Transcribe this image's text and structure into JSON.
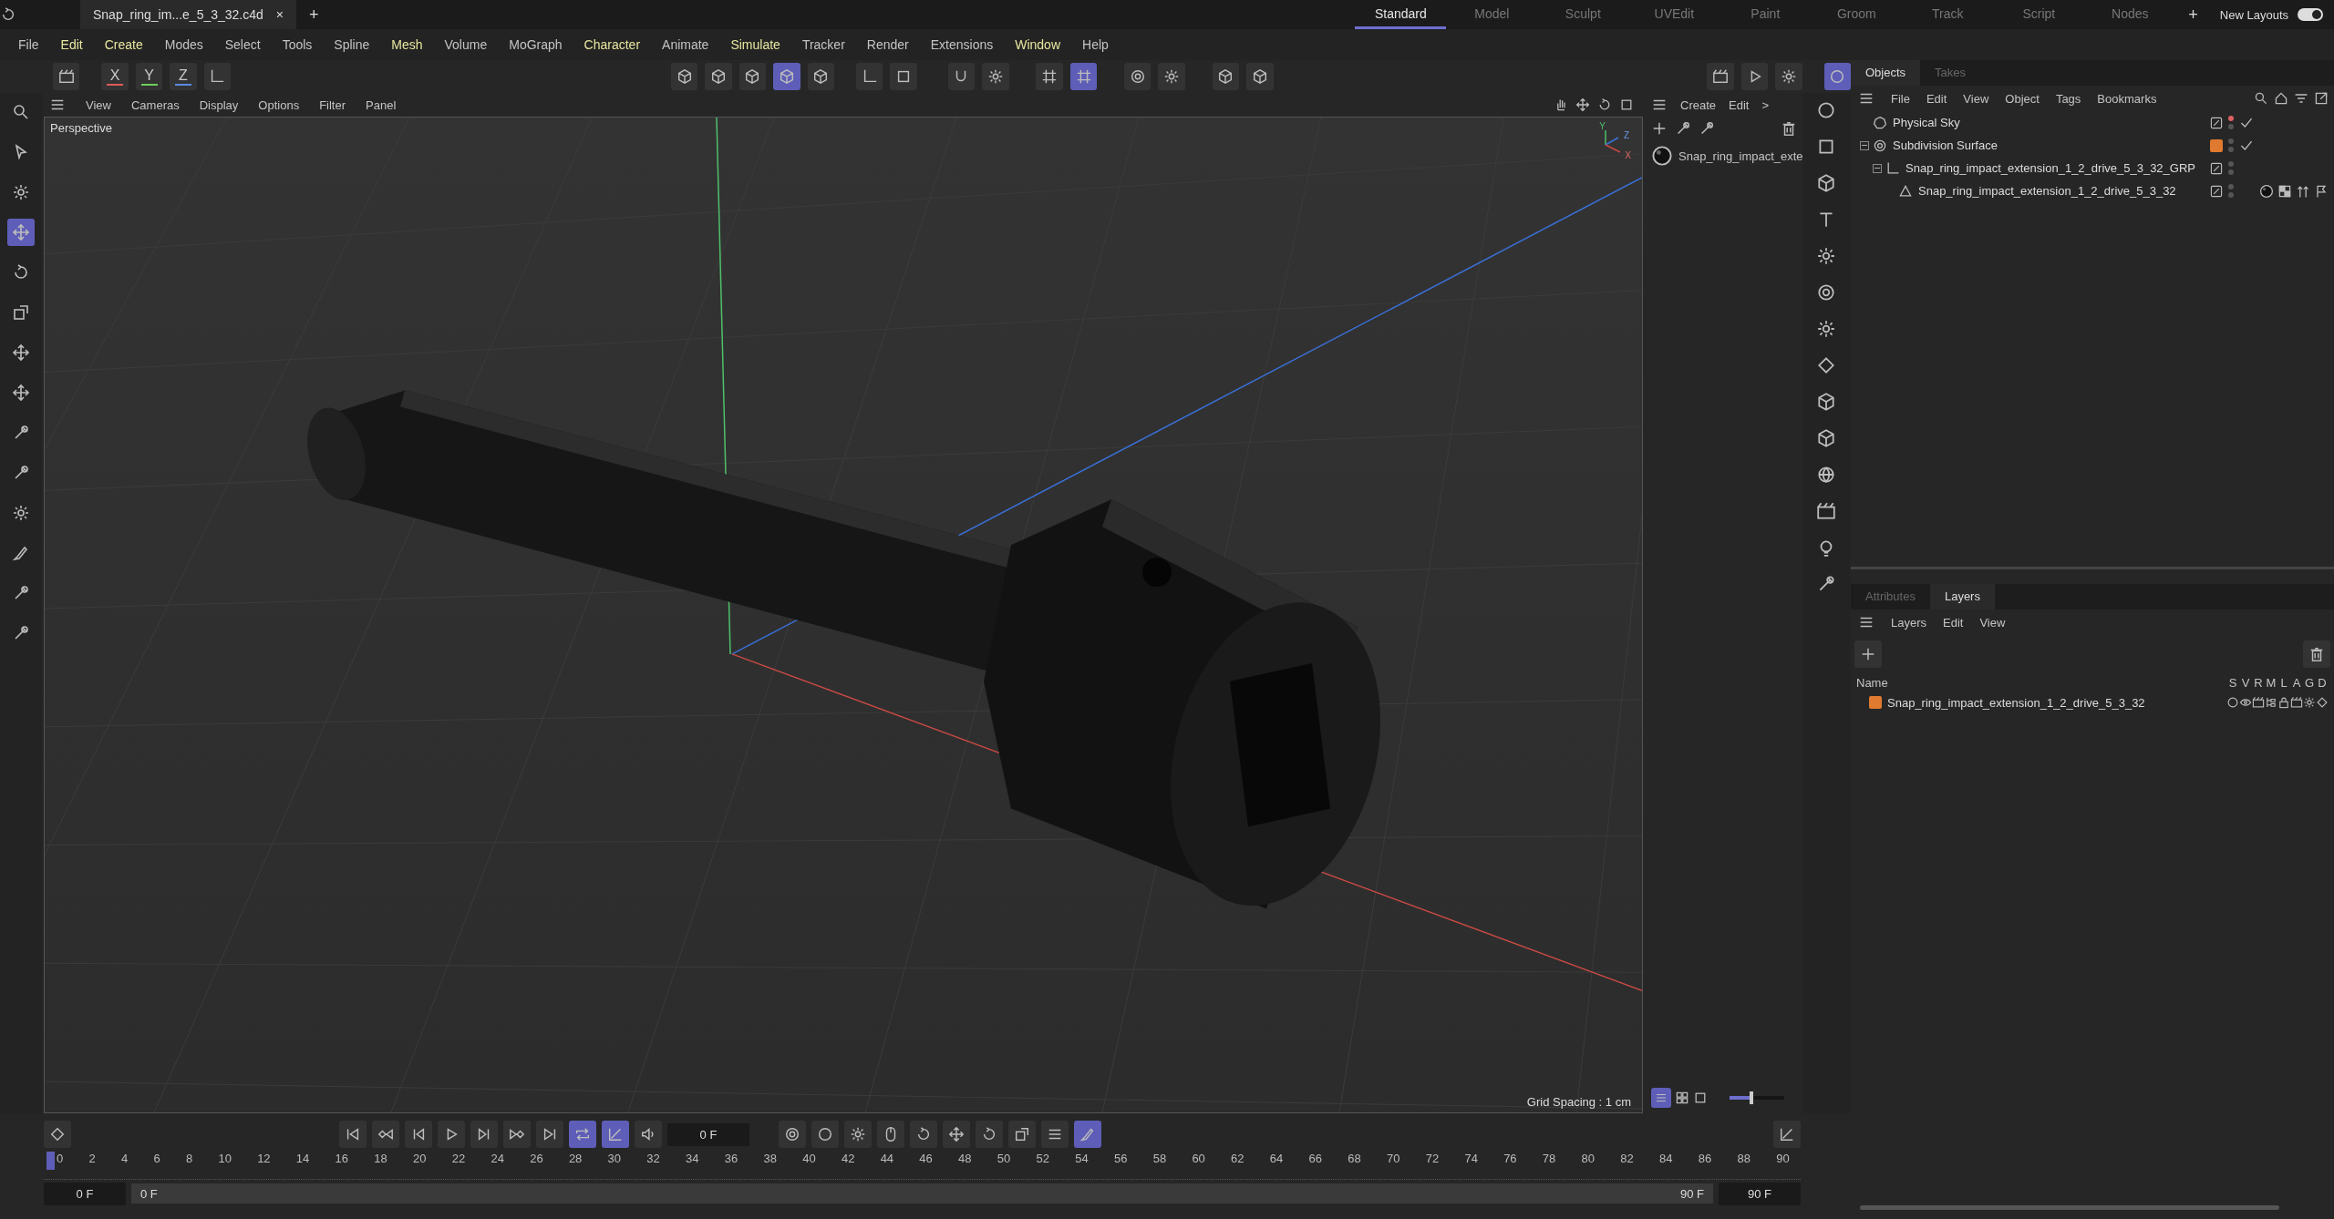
{
  "title_bar": {
    "tab": "Snap_ring_im...e_5_3_32.c4d",
    "close": "×",
    "add": "+"
  },
  "layouts": [
    {
      "label": "Standard",
      "selected": true
    },
    {
      "label": "Model",
      "selected": false
    },
    {
      "label": "Sculpt",
      "selected": false
    },
    {
      "label": "UVEdit",
      "selected": false
    },
    {
      "label": "Paint",
      "selected": false
    },
    {
      "label": "Groom",
      "selected": false
    },
    {
      "label": "Track",
      "selected": false
    },
    {
      "label": "Script",
      "selected": false
    },
    {
      "label": "Nodes",
      "selected": false
    }
  ],
  "layout_add": "+",
  "new_layouts": {
    "label": "New Layouts",
    "on": true
  },
  "menu": [
    {
      "label": "File",
      "highlight": false
    },
    {
      "label": "Edit",
      "highlight": true
    },
    {
      "label": "Create",
      "highlight": true
    },
    {
      "label": "Modes",
      "highlight": false
    },
    {
      "label": "Select",
      "highlight": false
    },
    {
      "label": "Tools",
      "highlight": false
    },
    {
      "label": "Spline",
      "highlight": false
    },
    {
      "label": "Mesh",
      "highlight": true
    },
    {
      "label": "Volume",
      "highlight": false
    },
    {
      "label": "MoGraph",
      "highlight": false
    },
    {
      "label": "Character",
      "highlight": true
    },
    {
      "label": "Animate",
      "highlight": false
    },
    {
      "label": "Simulate",
      "highlight": true
    },
    {
      "label": "Tracker",
      "highlight": false
    },
    {
      "label": "Render",
      "highlight": false
    },
    {
      "label": "Extensions",
      "highlight": false
    },
    {
      "label": "Window",
      "highlight": true
    },
    {
      "label": "Help",
      "highlight": false
    }
  ],
  "axis_lock": [
    {
      "label": "X",
      "color": "#e05a5a"
    },
    {
      "label": "Y",
      "color": "#6ccf5a"
    },
    {
      "label": "Z",
      "color": "#5a8ae0"
    }
  ],
  "viewport": {
    "menu": [
      "View",
      "Cameras",
      "Display",
      "Options",
      "Filter",
      "Panel"
    ],
    "camera": "Perspective",
    "gizmo": [
      "Y",
      "Z",
      "X"
    ],
    "grid_spacing": "Grid Spacing : 1 cm"
  },
  "material_panel": {
    "menu": [
      "Create",
      "Edit",
      ">"
    ],
    "materials": [
      {
        "name": "Snap_ring_impact_exte"
      }
    ],
    "zoom_slider": {
      "level": 0.4
    }
  },
  "objects_panel": {
    "tabs": [
      {
        "label": "Objects",
        "selected": true
      },
      {
        "label": "Takes",
        "selected": false
      }
    ],
    "menu": [
      "File",
      "Edit",
      "View",
      "Object",
      "Tags",
      "Bookmarks"
    ],
    "tree": [
      {
        "name": "Physical Sky",
        "kind": "sky",
        "editor_hidden": true,
        "enabled": true
      },
      {
        "name": "Subdivision Surface",
        "kind": "subdivision",
        "expanded": true,
        "color": "#e07a30",
        "editor_hidden": false,
        "enabled": true,
        "children": [
          {
            "name": "Snap_ring_impact_extension_1_2_drive_5_3_32_GRP",
            "kind": "group",
            "expanded": true,
            "editor_hidden": false,
            "enabled": false,
            "children": [
              {
                "name": "Snap_ring_impact_extension_1_2_drive_5_3_32",
                "kind": "mesh",
                "editor_hidden": false,
                "enabled": false,
                "tags": [
                  {
                    "kind": "material"
                  },
                  {
                    "kind": "uvw"
                  },
                  {
                    "kind": "phong"
                  },
                  {
                    "kind": "selection"
                  }
                ]
              }
            ]
          }
        ]
      }
    ]
  },
  "layers_panel": {
    "tabs": [
      {
        "label": "Attributes",
        "selected": false
      },
      {
        "label": "Layers",
        "selected": true
      }
    ],
    "menu": [
      "Layers",
      "Edit",
      "View"
    ],
    "name_header": "Name",
    "flags": [
      "S",
      "V",
      "R",
      "M",
      "L",
      "A",
      "G",
      "D"
    ],
    "layers": [
      {
        "name": "Snap_ring_impact_extension_1_2_drive_5_3_32",
        "color": "#e07a30"
      }
    ]
  },
  "timeline": {
    "current": "0 F",
    "ticks": [
      "0",
      "2",
      "4",
      "6",
      "8",
      "10",
      "12",
      "14",
      "16",
      "18",
      "20",
      "22",
      "24",
      "26",
      "28",
      "30",
      "32",
      "34",
      "36",
      "38",
      "40",
      "42",
      "44",
      "46",
      "48",
      "50",
      "52",
      "54",
      "56",
      "58",
      "60",
      "62",
      "64",
      "66",
      "68",
      "70",
      "72",
      "74",
      "76",
      "78",
      "80",
      "82",
      "84",
      "86",
      "88",
      "90"
    ],
    "start": "0 F",
    "range_start": "0 F",
    "range_end": "90 F",
    "end": "90 F"
  }
}
